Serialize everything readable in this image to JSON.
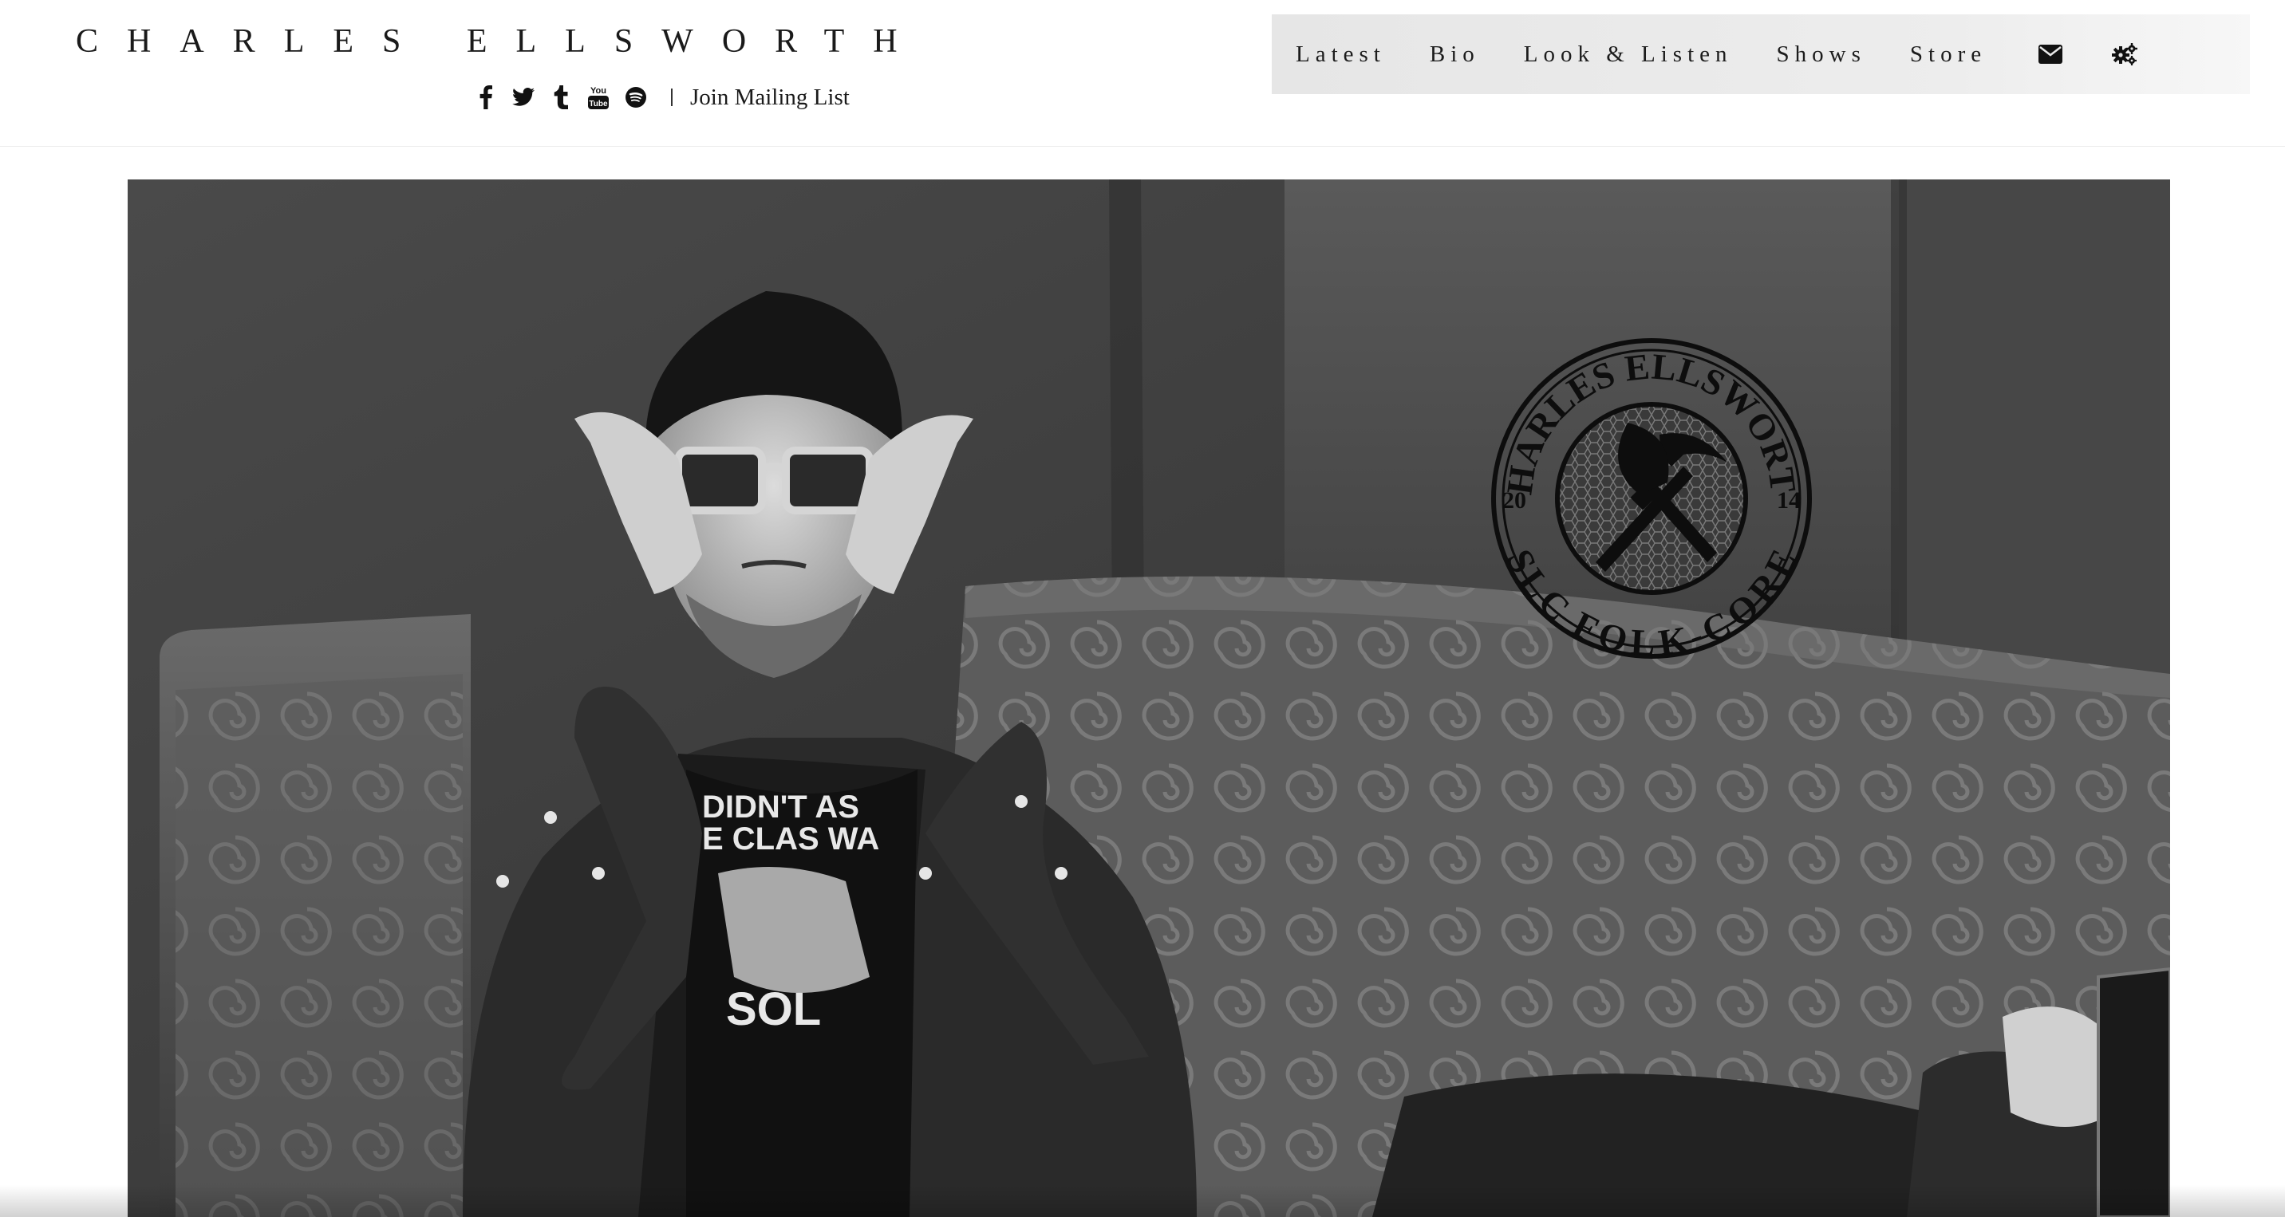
{
  "site": {
    "title": "CHARLES ELLSWORTH",
    "mailing_link": "Join Mailing List"
  },
  "social": {
    "icons": [
      "facebook-icon",
      "twitter-icon",
      "tumblr-icon",
      "youtube-icon",
      "spotify-icon"
    ],
    "youtube_glyph_top": "You",
    "youtube_glyph_bottom": "Tube"
  },
  "nav": {
    "items": [
      "Latest",
      "Bio",
      "Look & Listen",
      "Shows",
      "Store"
    ],
    "icons": [
      "envelope-icon",
      "gears-icon"
    ],
    "bg_color": "#e8e8e8"
  },
  "hero": {
    "description_icons": [
      "photo-of-musician",
      "band-logo-seal"
    ],
    "shirt_line1": "DIDN'T AS",
    "shirt_line2": "E CLAS WA",
    "shirt_line3": "SOL",
    "logo": {
      "arc_top": "CHARLES ELLSWORTH",
      "arc_bottom": "SLC FOLK-CORE",
      "year_left": "20",
      "year_right": "14"
    }
  }
}
